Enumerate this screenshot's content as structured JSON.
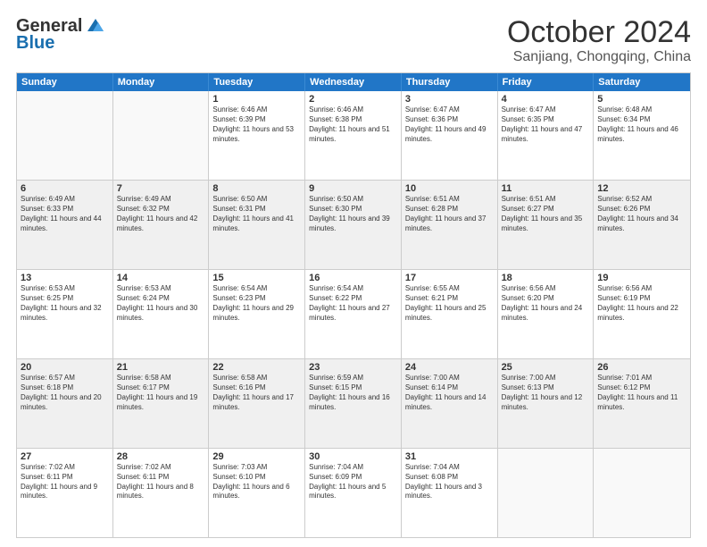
{
  "logo": {
    "line1": "General",
    "line2": "Blue"
  },
  "title": "October 2024",
  "subtitle": "Sanjiang, Chongqing, China",
  "days": [
    "Sunday",
    "Monday",
    "Tuesday",
    "Wednesday",
    "Thursday",
    "Friday",
    "Saturday"
  ],
  "weeks": [
    [
      {
        "day": "",
        "sunrise": "",
        "sunset": "",
        "daylight": "",
        "shaded": false,
        "empty": true
      },
      {
        "day": "",
        "sunrise": "",
        "sunset": "",
        "daylight": "",
        "shaded": false,
        "empty": true
      },
      {
        "day": "1",
        "sunrise": "Sunrise: 6:46 AM",
        "sunset": "Sunset: 6:39 PM",
        "daylight": "Daylight: 11 hours and 53 minutes.",
        "shaded": false,
        "empty": false
      },
      {
        "day": "2",
        "sunrise": "Sunrise: 6:46 AM",
        "sunset": "Sunset: 6:38 PM",
        "daylight": "Daylight: 11 hours and 51 minutes.",
        "shaded": false,
        "empty": false
      },
      {
        "day": "3",
        "sunrise": "Sunrise: 6:47 AM",
        "sunset": "Sunset: 6:36 PM",
        "daylight": "Daylight: 11 hours and 49 minutes.",
        "shaded": false,
        "empty": false
      },
      {
        "day": "4",
        "sunrise": "Sunrise: 6:47 AM",
        "sunset": "Sunset: 6:35 PM",
        "daylight": "Daylight: 11 hours and 47 minutes.",
        "shaded": false,
        "empty": false
      },
      {
        "day": "5",
        "sunrise": "Sunrise: 6:48 AM",
        "sunset": "Sunset: 6:34 PM",
        "daylight": "Daylight: 11 hours and 46 minutes.",
        "shaded": false,
        "empty": false
      }
    ],
    [
      {
        "day": "6",
        "sunrise": "Sunrise: 6:49 AM",
        "sunset": "Sunset: 6:33 PM",
        "daylight": "Daylight: 11 hours and 44 minutes.",
        "shaded": true,
        "empty": false
      },
      {
        "day": "7",
        "sunrise": "Sunrise: 6:49 AM",
        "sunset": "Sunset: 6:32 PM",
        "daylight": "Daylight: 11 hours and 42 minutes.",
        "shaded": true,
        "empty": false
      },
      {
        "day": "8",
        "sunrise": "Sunrise: 6:50 AM",
        "sunset": "Sunset: 6:31 PM",
        "daylight": "Daylight: 11 hours and 41 minutes.",
        "shaded": true,
        "empty": false
      },
      {
        "day": "9",
        "sunrise": "Sunrise: 6:50 AM",
        "sunset": "Sunset: 6:30 PM",
        "daylight": "Daylight: 11 hours and 39 minutes.",
        "shaded": true,
        "empty": false
      },
      {
        "day": "10",
        "sunrise": "Sunrise: 6:51 AM",
        "sunset": "Sunset: 6:28 PM",
        "daylight": "Daylight: 11 hours and 37 minutes.",
        "shaded": true,
        "empty": false
      },
      {
        "day": "11",
        "sunrise": "Sunrise: 6:51 AM",
        "sunset": "Sunset: 6:27 PM",
        "daylight": "Daylight: 11 hours and 35 minutes.",
        "shaded": true,
        "empty": false
      },
      {
        "day": "12",
        "sunrise": "Sunrise: 6:52 AM",
        "sunset": "Sunset: 6:26 PM",
        "daylight": "Daylight: 11 hours and 34 minutes.",
        "shaded": true,
        "empty": false
      }
    ],
    [
      {
        "day": "13",
        "sunrise": "Sunrise: 6:53 AM",
        "sunset": "Sunset: 6:25 PM",
        "daylight": "Daylight: 11 hours and 32 minutes.",
        "shaded": false,
        "empty": false
      },
      {
        "day": "14",
        "sunrise": "Sunrise: 6:53 AM",
        "sunset": "Sunset: 6:24 PM",
        "daylight": "Daylight: 11 hours and 30 minutes.",
        "shaded": false,
        "empty": false
      },
      {
        "day": "15",
        "sunrise": "Sunrise: 6:54 AM",
        "sunset": "Sunset: 6:23 PM",
        "daylight": "Daylight: 11 hours and 29 minutes.",
        "shaded": false,
        "empty": false
      },
      {
        "day": "16",
        "sunrise": "Sunrise: 6:54 AM",
        "sunset": "Sunset: 6:22 PM",
        "daylight": "Daylight: 11 hours and 27 minutes.",
        "shaded": false,
        "empty": false
      },
      {
        "day": "17",
        "sunrise": "Sunrise: 6:55 AM",
        "sunset": "Sunset: 6:21 PM",
        "daylight": "Daylight: 11 hours and 25 minutes.",
        "shaded": false,
        "empty": false
      },
      {
        "day": "18",
        "sunrise": "Sunrise: 6:56 AM",
        "sunset": "Sunset: 6:20 PM",
        "daylight": "Daylight: 11 hours and 24 minutes.",
        "shaded": false,
        "empty": false
      },
      {
        "day": "19",
        "sunrise": "Sunrise: 6:56 AM",
        "sunset": "Sunset: 6:19 PM",
        "daylight": "Daylight: 11 hours and 22 minutes.",
        "shaded": false,
        "empty": false
      }
    ],
    [
      {
        "day": "20",
        "sunrise": "Sunrise: 6:57 AM",
        "sunset": "Sunset: 6:18 PM",
        "daylight": "Daylight: 11 hours and 20 minutes.",
        "shaded": true,
        "empty": false
      },
      {
        "day": "21",
        "sunrise": "Sunrise: 6:58 AM",
        "sunset": "Sunset: 6:17 PM",
        "daylight": "Daylight: 11 hours and 19 minutes.",
        "shaded": true,
        "empty": false
      },
      {
        "day": "22",
        "sunrise": "Sunrise: 6:58 AM",
        "sunset": "Sunset: 6:16 PM",
        "daylight": "Daylight: 11 hours and 17 minutes.",
        "shaded": true,
        "empty": false
      },
      {
        "day": "23",
        "sunrise": "Sunrise: 6:59 AM",
        "sunset": "Sunset: 6:15 PM",
        "daylight": "Daylight: 11 hours and 16 minutes.",
        "shaded": true,
        "empty": false
      },
      {
        "day": "24",
        "sunrise": "Sunrise: 7:00 AM",
        "sunset": "Sunset: 6:14 PM",
        "daylight": "Daylight: 11 hours and 14 minutes.",
        "shaded": true,
        "empty": false
      },
      {
        "day": "25",
        "sunrise": "Sunrise: 7:00 AM",
        "sunset": "Sunset: 6:13 PM",
        "daylight": "Daylight: 11 hours and 12 minutes.",
        "shaded": true,
        "empty": false
      },
      {
        "day": "26",
        "sunrise": "Sunrise: 7:01 AM",
        "sunset": "Sunset: 6:12 PM",
        "daylight": "Daylight: 11 hours and 11 minutes.",
        "shaded": true,
        "empty": false
      }
    ],
    [
      {
        "day": "27",
        "sunrise": "Sunrise: 7:02 AM",
        "sunset": "Sunset: 6:11 PM",
        "daylight": "Daylight: 11 hours and 9 minutes.",
        "shaded": false,
        "empty": false
      },
      {
        "day": "28",
        "sunrise": "Sunrise: 7:02 AM",
        "sunset": "Sunset: 6:11 PM",
        "daylight": "Daylight: 11 hours and 8 minutes.",
        "shaded": false,
        "empty": false
      },
      {
        "day": "29",
        "sunrise": "Sunrise: 7:03 AM",
        "sunset": "Sunset: 6:10 PM",
        "daylight": "Daylight: 11 hours and 6 minutes.",
        "shaded": false,
        "empty": false
      },
      {
        "day": "30",
        "sunrise": "Sunrise: 7:04 AM",
        "sunset": "Sunset: 6:09 PM",
        "daylight": "Daylight: 11 hours and 5 minutes.",
        "shaded": false,
        "empty": false
      },
      {
        "day": "31",
        "sunrise": "Sunrise: 7:04 AM",
        "sunset": "Sunset: 6:08 PM",
        "daylight": "Daylight: 11 hours and 3 minutes.",
        "shaded": false,
        "empty": false
      },
      {
        "day": "",
        "sunrise": "",
        "sunset": "",
        "daylight": "",
        "shaded": false,
        "empty": true
      },
      {
        "day": "",
        "sunrise": "",
        "sunset": "",
        "daylight": "",
        "shaded": false,
        "empty": true
      }
    ]
  ]
}
